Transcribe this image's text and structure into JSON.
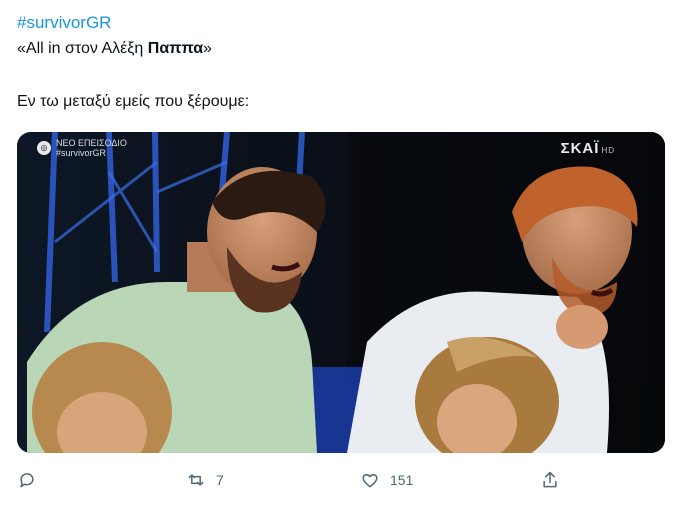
{
  "tweet": {
    "hashtag": "#survivorGR",
    "quote_prefix": "«All in στον Αλέξη ",
    "quote_bold": "Παππα",
    "quote_suffix": "»",
    "caption": "Εν τω μεταξύ εμείς που ξέρουμε:"
  },
  "media": {
    "overlay_left_line1": "ΝΕΟ ΕΠΕΙΣΟΔΙΟ",
    "overlay_left_line2": "#survivorGR",
    "overlay_channel": "ΣΚΑΪ",
    "overlay_channel_hd": "HD"
  },
  "actions": {
    "reply_icon": "reply-icon",
    "retweet_icon": "retweet-icon",
    "retweet_count": "7",
    "like_icon": "heart-icon",
    "like_count": "151",
    "share_icon": "share-icon"
  },
  "colors": {
    "hashtag": "#1b95e0",
    "icon_gray": "#536471"
  }
}
